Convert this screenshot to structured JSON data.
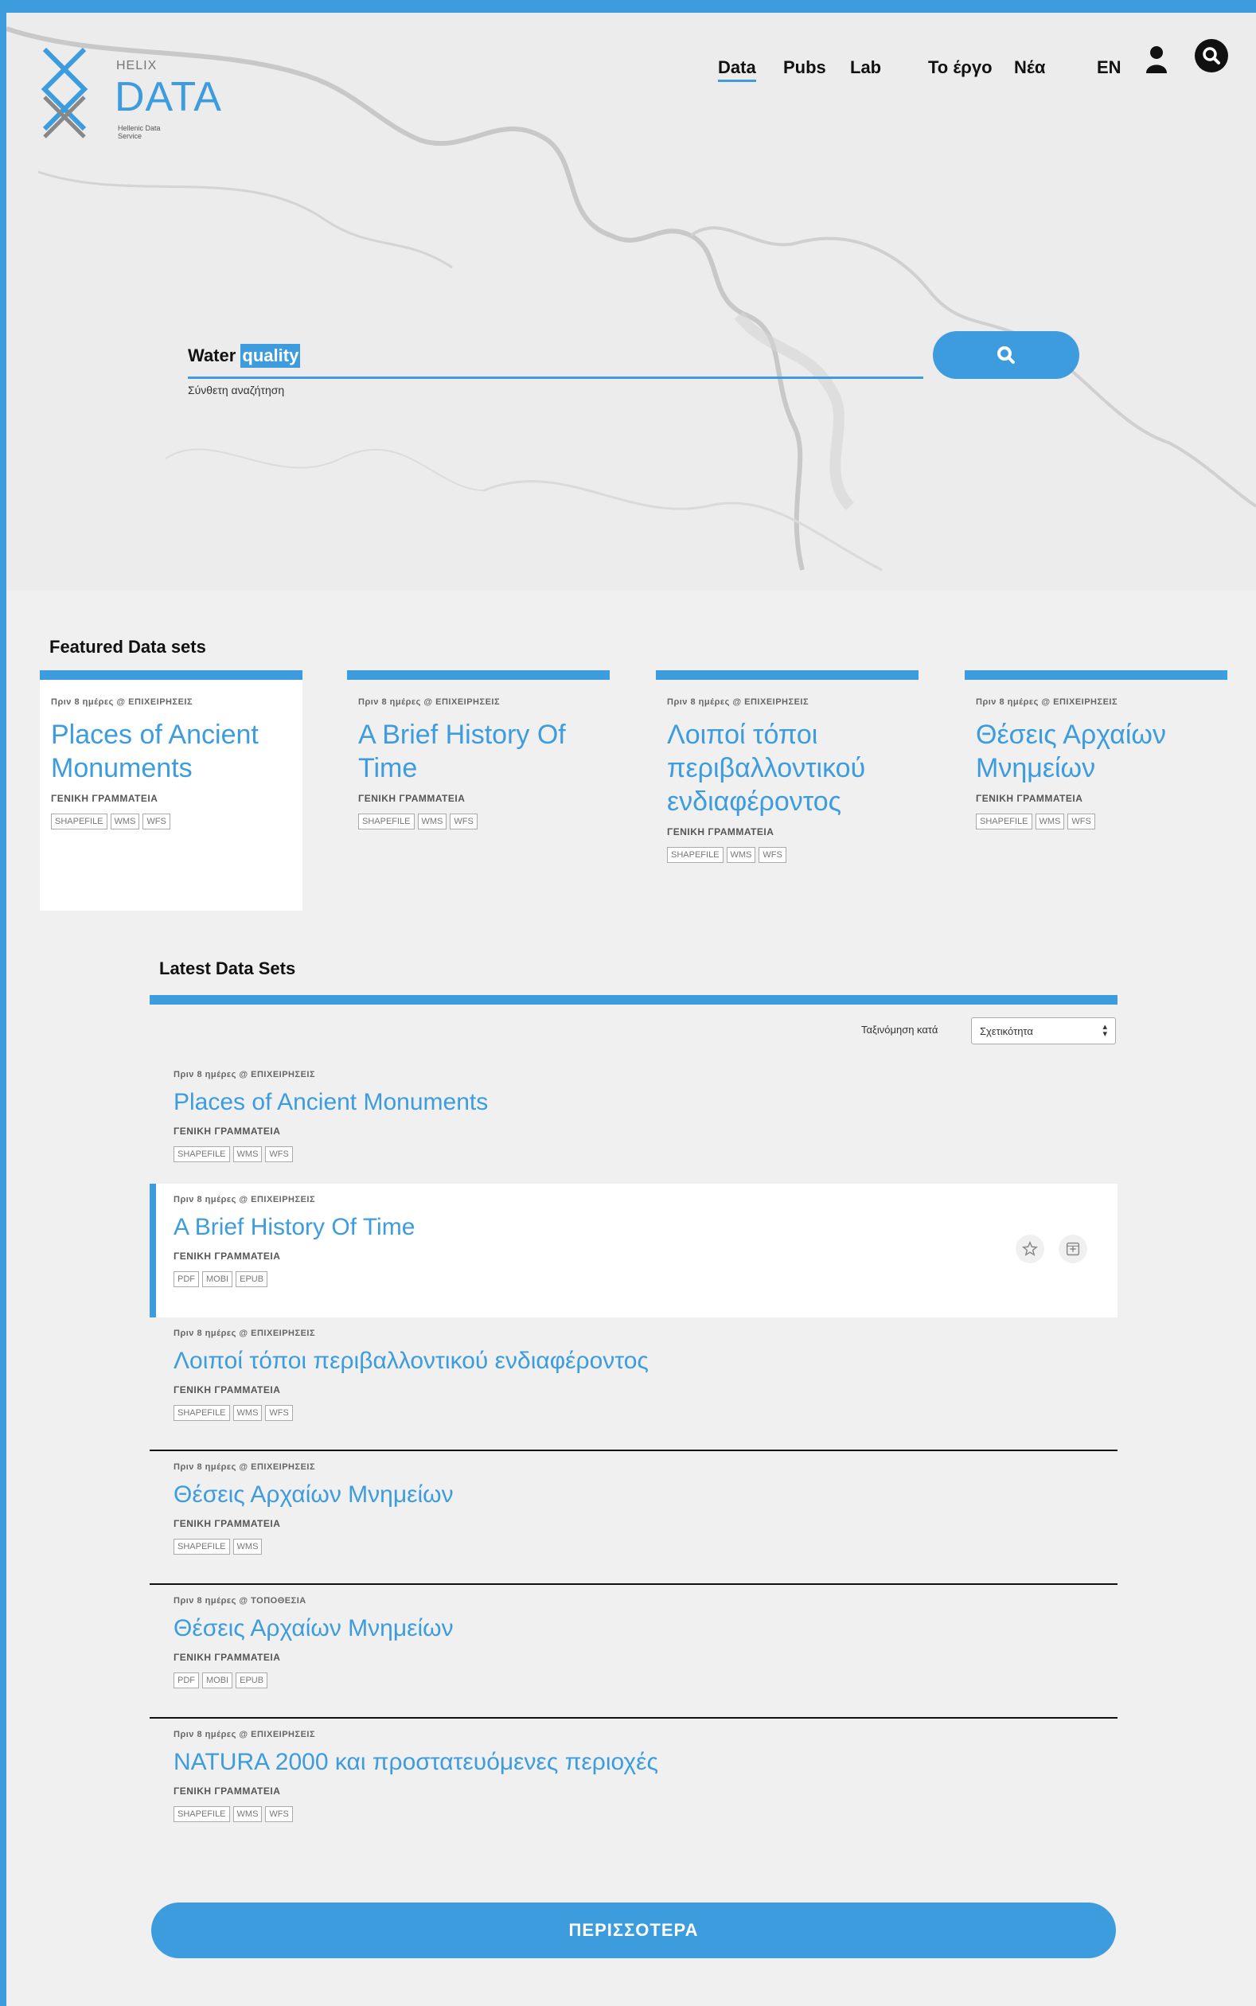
{
  "header": {
    "logo": {
      "brand_small": "HELIX",
      "brand_large": "DATA",
      "tagline": "Hellenic Data Service"
    },
    "nav": [
      "Data",
      "Pubs",
      "Lab",
      "Το έργο",
      "Νέα",
      "EN"
    ],
    "active_nav": "Data",
    "icons": [
      "user-icon",
      "search-icon"
    ]
  },
  "search": {
    "query_plain": "Water ",
    "query_selected": "quality",
    "advanced_label": "Σύνθετη αναζήτηση"
  },
  "featured": {
    "title": "Featured Data sets",
    "cards": [
      {
        "meta": "Πριν 8 ημέρες  @  ΕΠΙΧΕΙΡΗΣΕΙΣ",
        "title": "Places of Ancient Monuments",
        "org": "ΓΕΝΙΚΗ ΓΡΑΜΜΑΤΕΙΑ",
        "tags": [
          "SHAPEFILE",
          "WMS",
          "WFS"
        ]
      },
      {
        "meta": "Πριν 8 ημέρες  @  ΕΠΙΧΕΙΡΗΣΕΙΣ",
        "title": "A Brief History Of Time",
        "org": "ΓΕΝΙΚΗ ΓΡΑΜΜΑΤΕΙΑ",
        "tags": [
          "SHAPEFILE",
          "WMS",
          "WFS"
        ]
      },
      {
        "meta": "Πριν 8 ημέρες  @  ΕΠΙΧΕΙΡΗΣΕΙΣ",
        "title": "Λοιποί τόποι περιβαλλοντικού ενδιαφέροντος",
        "org": "ΓΕΝΙΚΗ ΓΡΑΜΜΑΤΕΙΑ",
        "tags": [
          "SHAPEFILE",
          "WMS",
          "WFS"
        ]
      },
      {
        "meta": "Πριν 8 ημέρες  @  ΕΠΙΧΕΙΡΗΣΕΙΣ",
        "title": "Θέσεις Αρχαίων Μνημείων",
        "org": "ΓΕΝΙΚΗ ΓΡΑΜΜΑΤΕΙΑ",
        "tags": [
          "SHAPEFILE",
          "WMS",
          "WFS"
        ]
      }
    ]
  },
  "latest": {
    "title": "Latest Data Sets",
    "sort_label": "Ταξινόμηση κατά",
    "sort_value": "Σχετικότητα",
    "rows": [
      {
        "meta": "Πριν 8 ημέρες  @  ΕΠΙΧΕΙΡΗΣΕΙΣ",
        "title": "Places of Ancient Monuments",
        "org": "ΓΕΝΙΚΗ ΓΡΑΜΜΑΤΕΙΑ",
        "tags": [
          "SHAPEFILE",
          "WMS",
          "WFS"
        ]
      },
      {
        "meta": "Πριν 8 ημέρες  @  ΕΠΙΧΕΙΡΗΣΕΙΣ",
        "title": "A Brief History Of Time",
        "org": "ΓΕΝΙΚΗ ΓΡΑΜΜΑΤΕΙΑ",
        "tags": [
          "PDF",
          "MOBI",
          "EPUB"
        ],
        "icons": [
          "star-icon",
          "add-icon"
        ]
      },
      {
        "meta": "Πριν 8 ημέρες  @  ΕΠΙΧΕΙΡΗΣΕΙΣ",
        "title": "Λοιποί τόποι περιβαλλοντικού ενδιαφέροντος",
        "org": "ΓΕΝΙΚΗ ΓΡΑΜΜΑΤΕΙΑ",
        "tags": [
          "SHAPEFILE",
          "WMS",
          "WFS"
        ]
      },
      {
        "meta": "Πριν 8 ημέρες  @  ΕΠΙΧΕΙΡΗΣΕΙΣ",
        "title": "Θέσεις Αρχαίων Μνημείων",
        "org": "ΓΕΝΙΚΗ ΓΡΑΜΜΑΤΕΙΑ",
        "tags": [
          "SHAPEFILE",
          "WMS"
        ]
      },
      {
        "meta": "Πριν 8 ημέρες  @  ΤΟΠΟΘΕΣΙΑ",
        "title": "Θέσεις Αρχαίων Μνημείων",
        "org": "ΓΕΝΙΚΗ ΓΡΑΜΜΑΤΕΙΑ",
        "tags": [
          "PDF",
          "MOBI",
          "EPUB"
        ]
      },
      {
        "meta": "Πριν 8 ημέρες  @  ΕΠΙΧΕΙΡΗΣΕΙΣ",
        "title": "NATURA 2000 και προστατευόμενες περιοχές",
        "org": "ΓΕΝΙΚΗ ΓΡΑΜΜΑΤΕΙΑ",
        "tags": [
          "SHAPEFILE",
          "WMS",
          "WFS"
        ]
      }
    ],
    "more_label": "ΠΕΡΙΣΣΟΤΕΡΑ"
  },
  "colors": {
    "accent": "#3d9cde",
    "background": "#f0f0f0",
    "text": "#111111"
  }
}
